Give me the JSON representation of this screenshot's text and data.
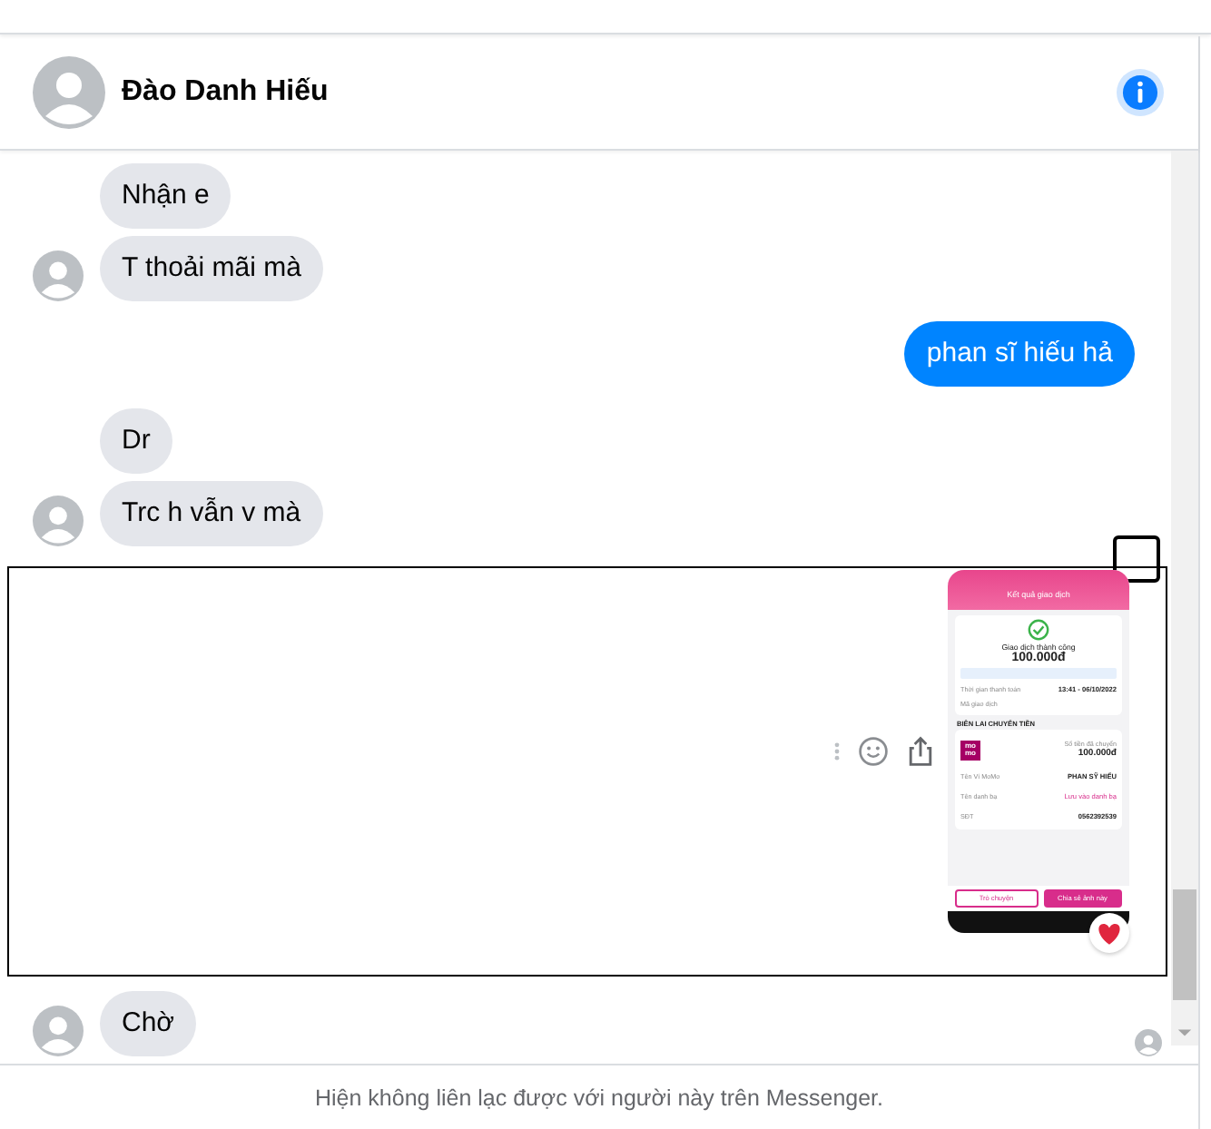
{
  "header": {
    "name": "Đào Danh Hiếu"
  },
  "messages": [
    {
      "kind": "received",
      "text": "Nhận e",
      "show_avatar": false
    },
    {
      "kind": "received",
      "text": "T thoải mãi mà",
      "show_avatar": true
    },
    {
      "kind": "sent",
      "text": "phan sĩ hiếu hả"
    },
    {
      "kind": "received",
      "text": "Dr",
      "show_avatar": false
    },
    {
      "kind": "received",
      "text": "Trc h vẫn v mà",
      "show_avatar": true
    },
    {
      "kind": "image",
      "focused": true,
      "reacted": true,
      "receipt": {
        "title": "Kết quả giao dịch",
        "status": "Giao dịch thành công",
        "amount": "100.000đ",
        "rows": [
          {
            "label": "Thời gian thanh toán",
            "value": "13:41 - 06/10/2022"
          },
          {
            "label": "Mã giao dịch"
          }
        ],
        "section": "BIÊN LAI CHUYỂN TIỀN",
        "logo": [
          "mo",
          "mo"
        ],
        "sent_label": "Số tiền đã chuyển",
        "sent_amount": "100.000đ",
        "details": [
          {
            "label": "Tên Ví MoMo",
            "value": "PHAN SỸ HIẾU",
            "kind": "plain"
          },
          {
            "label": "Tên danh bạ",
            "value": "Lưu vào danh bạ",
            "kind": "link"
          },
          {
            "label": "SĐT",
            "value": "0562392539",
            "kind": "plain"
          }
        ],
        "buttons": [
          "Trò chuyện",
          "Chia sẻ ảnh này"
        ]
      }
    },
    {
      "kind": "received",
      "text": "Chờ",
      "show_avatar": true,
      "seen": true
    }
  ],
  "footer": "Hiện không liên lạc được với người này trên Messenger."
}
